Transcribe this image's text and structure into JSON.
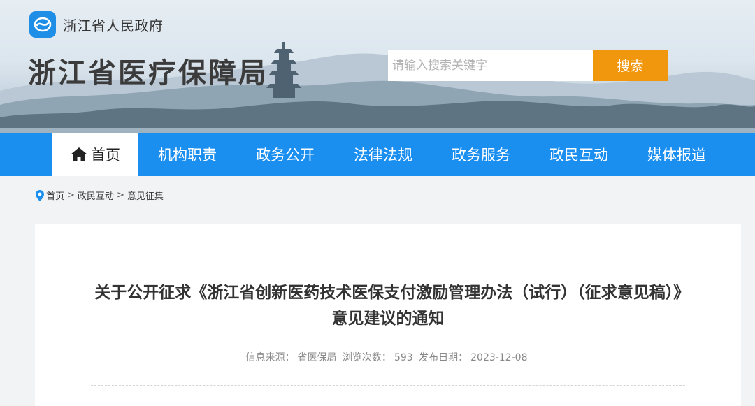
{
  "header": {
    "gov_name": "浙江省人民政府",
    "site_title": "浙江省医疗保障局",
    "search_placeholder": "请输入搜索关键字",
    "search_button": "搜索",
    "logo_icon": "zhejiang-gov-logo-icon",
    "accent_color": "#f0970d"
  },
  "nav": {
    "color": "#1b8ff0",
    "items": [
      {
        "label": "首页",
        "icon": "home-icon",
        "active": true
      },
      {
        "label": "机构职责"
      },
      {
        "label": "政务公开"
      },
      {
        "label": "法律法规"
      },
      {
        "label": "政务服务"
      },
      {
        "label": "政民互动"
      },
      {
        "label": "媒体报道"
      }
    ]
  },
  "breadcrumb": {
    "icon": "location-pin-icon",
    "items": [
      "首页",
      "政民互动",
      "意见征集"
    ],
    "separator": ">"
  },
  "article": {
    "title": "关于公开征求《浙江省创新医药技术医保支付激励管理办法（试行）（征求意见稿）》意见建议的通知",
    "meta": {
      "source_label": "信息来源：",
      "source": "省医保局",
      "views_label": "浏览次数：",
      "views": "593",
      "date_label": "发布日期：",
      "date": "2023-12-08"
    }
  }
}
